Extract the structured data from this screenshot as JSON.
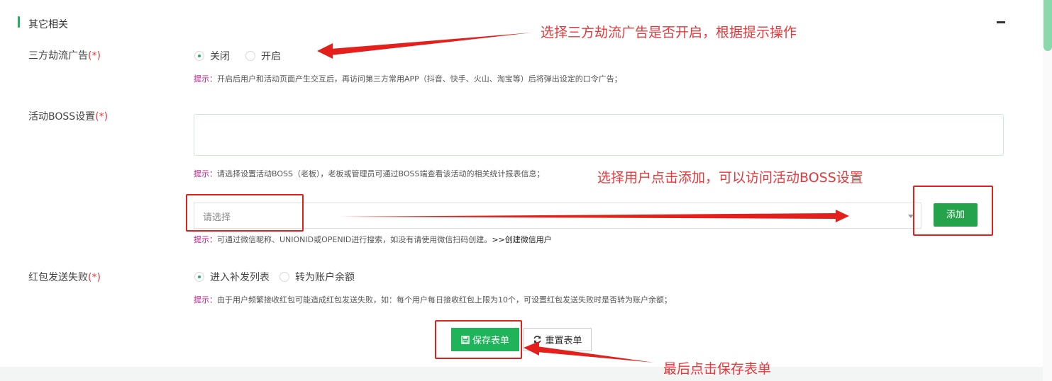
{
  "section": {
    "title": "其它相关"
  },
  "ads": {
    "label": "三方劫流广告",
    "required": "(*)",
    "options": [
      {
        "label": "关闭",
        "checked": true
      },
      {
        "label": "开启",
        "checked": false
      }
    ],
    "tip_key": "提示：",
    "tip_text": "开启后用户和活动页面产生交互后，再访问第三方常用APP（抖音、快手、火山、淘宝等）后将弹出设定的口令广告；"
  },
  "boss": {
    "label": "活动BOSS设置",
    "required": "(*)",
    "tip_key": "提示：",
    "tip_text": "请选择设置活动BOSS（老板），老板或管理员可通过BOSS端查看该活动的相关统计报表信息；",
    "select_placeholder": "请选择",
    "add_button": "添加",
    "search_tip_key": "提示：",
    "search_tip_text": "可通过微信昵称、UNIONID或OPENID进行搜索，如没有请使用微信扫码创建。",
    "create_link": ">>创建微信用户"
  },
  "redpack": {
    "label": "红包发送失败",
    "required": "(*)",
    "options": [
      {
        "label": "进入补发列表",
        "checked": true
      },
      {
        "label": "转为账户余额",
        "checked": false
      }
    ],
    "tip_key": "提示：",
    "tip_text": "由于用户频繁接收红包可能造成红包发送失败，如：每个用户每日接收红包上限为10个，可设置红包发送失败时是否转为账户余额；"
  },
  "actions": {
    "save": "保存表单",
    "reset": "重置表单"
  },
  "annotations": {
    "a1": "选择三方劫流广告是否开启，根据提示操作",
    "a2": "选择用户点击添加，可以访问活动BOSS设置",
    "a3": "最后点击保存表单"
  },
  "colors": {
    "accent": "#1fb35a",
    "annotation": "#e4393c"
  }
}
